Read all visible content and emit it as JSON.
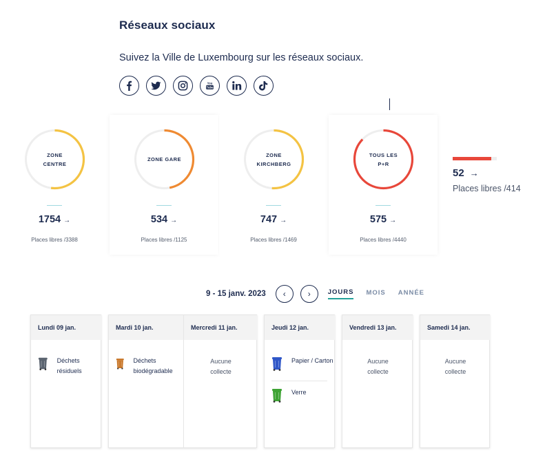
{
  "social": {
    "title": "Réseaux sociaux",
    "text": "Suivez la Ville de Luxembourg sur les réseaux sociaux.",
    "icons": [
      "facebook-icon",
      "twitter-icon",
      "instagram-icon",
      "youtube-icon",
      "linkedin-icon",
      "tiktok-icon"
    ]
  },
  "parking": {
    "zones": [
      {
        "label": "ZONE CENTRE",
        "count": "1754",
        "sub": "Places libres /3388",
        "fill_fraction": 0.52,
        "color": "#f4c343"
      },
      {
        "label": "ZONE GARE",
        "count": "534",
        "sub": "Places libres /1125",
        "fill_fraction": 0.47,
        "color": "#ef8a32"
      },
      {
        "label": "ZONE KIRCHBERG",
        "count": "747",
        "sub": "Places libres /1469",
        "fill_fraction": 0.51,
        "color": "#f4c343"
      },
      {
        "label": "TOUS LES P+R",
        "count": "575",
        "sub": "Places libres /4440",
        "fill_fraction": 0.87,
        "color": "#e8473a"
      }
    ],
    "extra": {
      "count": "52",
      "sub": "Places libres /414",
      "fill_fraction": 0.87,
      "color": "#e8473a"
    },
    "arrow": "→"
  },
  "calendar": {
    "range": "9 - 15 janv. 2023",
    "prev": "‹",
    "next": "›",
    "tabs": [
      "JOURS",
      "MOIS",
      "ANNÉE"
    ],
    "active_tab": "JOURS",
    "days": [
      {
        "name": "Lundi 09 jan.",
        "items": [
          {
            "text": "Déchets résiduels",
            "bin_color": "#5b6470"
          }
        ]
      },
      {
        "name": "Mardi 10 jan.",
        "items": [
          {
            "text": "Déchets biodégradable",
            "bin_color": "#c9782b"
          }
        ]
      },
      {
        "name": "Mercredi 11 jan.",
        "none": "Aucune collecte"
      },
      {
        "name": "Jeudi 12 jan.",
        "items": [
          {
            "text": "Papier / Carton",
            "bin_color": "#2f57c8"
          },
          {
            "text": "Verre",
            "bin_color": "#3ea334"
          }
        ]
      },
      {
        "name": "Vendredi 13 jan.",
        "none": "Aucune collecte"
      },
      {
        "name": "Samedi 14 jan.",
        "none": "Aucune collecte"
      }
    ]
  }
}
